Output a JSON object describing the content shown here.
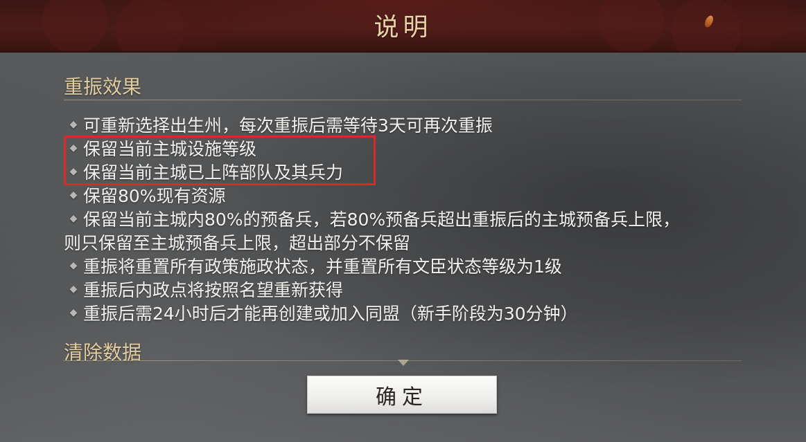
{
  "dialog": {
    "title": "说明",
    "sections": [
      {
        "heading": "重振效果",
        "items": [
          "可重新选择出生州，每次重振后需等待3天可再次重振",
          "保留当前主城设施等级",
          "保留当前主城已上阵部队及其兵力",
          "保留80%现有资源",
          "保留当前主城内80%的预备兵，若80%预备兵超出重振后的主城预备兵上限，",
          "则只保留至主城预备兵上限，超出部分不保留",
          "重振将重置所有政策施政状态，并重置所有文臣状态等级为1级",
          "重振后内政点将按照名望重新获得",
          "重振后需24小时后才能再创建或加入同盟（新手阶段为30分钟）"
        ]
      },
      {
        "heading": "清除数据"
      }
    ],
    "confirm_label": "确定"
  },
  "colors": {
    "title_bar": "#4a1b18",
    "heading_gold": "#e3cc9e",
    "highlight_red": "#d82a2a"
  }
}
